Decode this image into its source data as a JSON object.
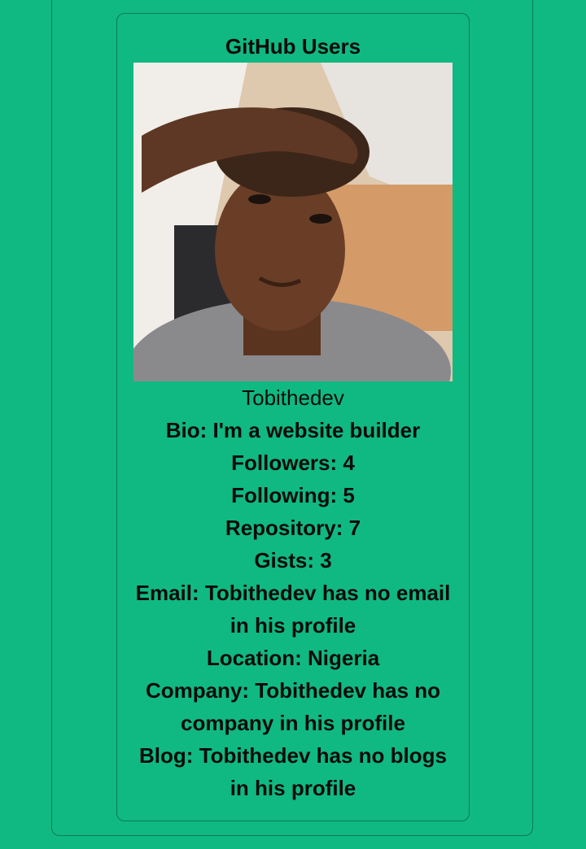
{
  "header": {
    "title": "GitHub Users"
  },
  "profile": {
    "username": "Tobithedev",
    "bio": "Bio: I'm a website builder",
    "followers": "Followers: 4",
    "following": "Following: 5",
    "repository": "Repository: 7",
    "gists": "Gists: 3",
    "email": "Email: Tobithedev has no email in his profile",
    "location": "Location: Nigeria",
    "company": "Company: Tobithedev has no company in his profile",
    "blog": "Blog: Tobithedev has no blogs in his profile",
    "avatar_alt": "Tobithedev avatar"
  },
  "colors": {
    "background": "#10b981",
    "border": "#0a7a55",
    "text": "#0b0b0b"
  }
}
